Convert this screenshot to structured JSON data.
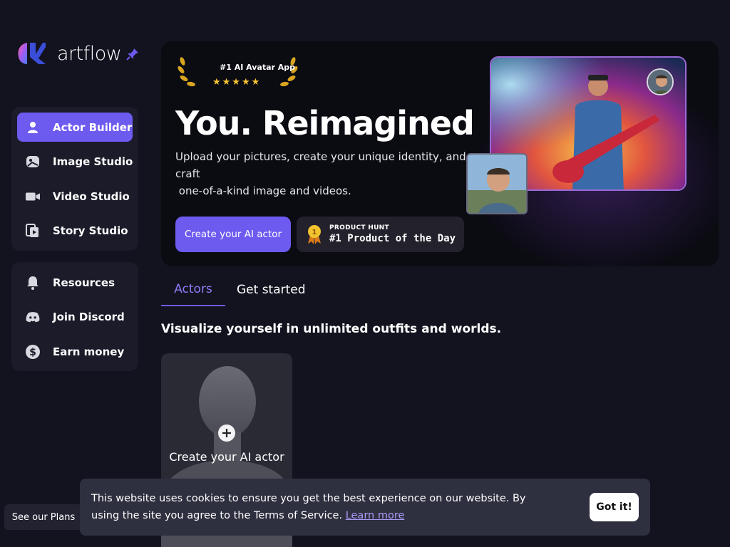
{
  "brand": {
    "name": "artflow"
  },
  "sidebar": {
    "main_items": [
      {
        "label": "Actor Builder",
        "icon": "user-icon",
        "active": true
      },
      {
        "label": "Image Studio",
        "icon": "image-icon",
        "active": false
      },
      {
        "label": "Video Studio",
        "icon": "video-camera-icon",
        "active": false
      },
      {
        "label": "Story Studio",
        "icon": "story-icon",
        "active": false
      }
    ],
    "secondary_items": [
      {
        "label": "Resources",
        "icon": "bell-icon"
      },
      {
        "label": "Join Discord",
        "icon": "discord-icon"
      },
      {
        "label": "Earn money",
        "icon": "dollar-icon"
      }
    ]
  },
  "hero": {
    "award_title": "#1 AI Avatar App",
    "award_stars": "★★★★★",
    "title": "You. Reimagined",
    "description_lines": [
      "Upload your pictures, create your unique identity, and",
      "craft",
      " one-of-a-kind image and videos."
    ],
    "cta_label": "Create your AI actor",
    "product_hunt": {
      "top": "PRODUCT HUNT",
      "main": "#1 Product of the Day",
      "medal": "1"
    }
  },
  "tabs": [
    {
      "label": "Actors",
      "active": true
    },
    {
      "label": "Get started",
      "active": false
    }
  ],
  "section_title": "Visualize yourself in unlimited outfits and worlds.",
  "actor_card": {
    "label": "Create your AI actor"
  },
  "cookie": {
    "text": "This website uses cookies to ensure you get the best experience on our website. By using the site you agree to the Terms of Service.",
    "link": "Learn more",
    "button": "Got it!"
  },
  "plans_button": "See our Plans",
  "colors": {
    "accent": "#6d5bf0",
    "background": "#13131f",
    "card": "#1b1b29"
  }
}
